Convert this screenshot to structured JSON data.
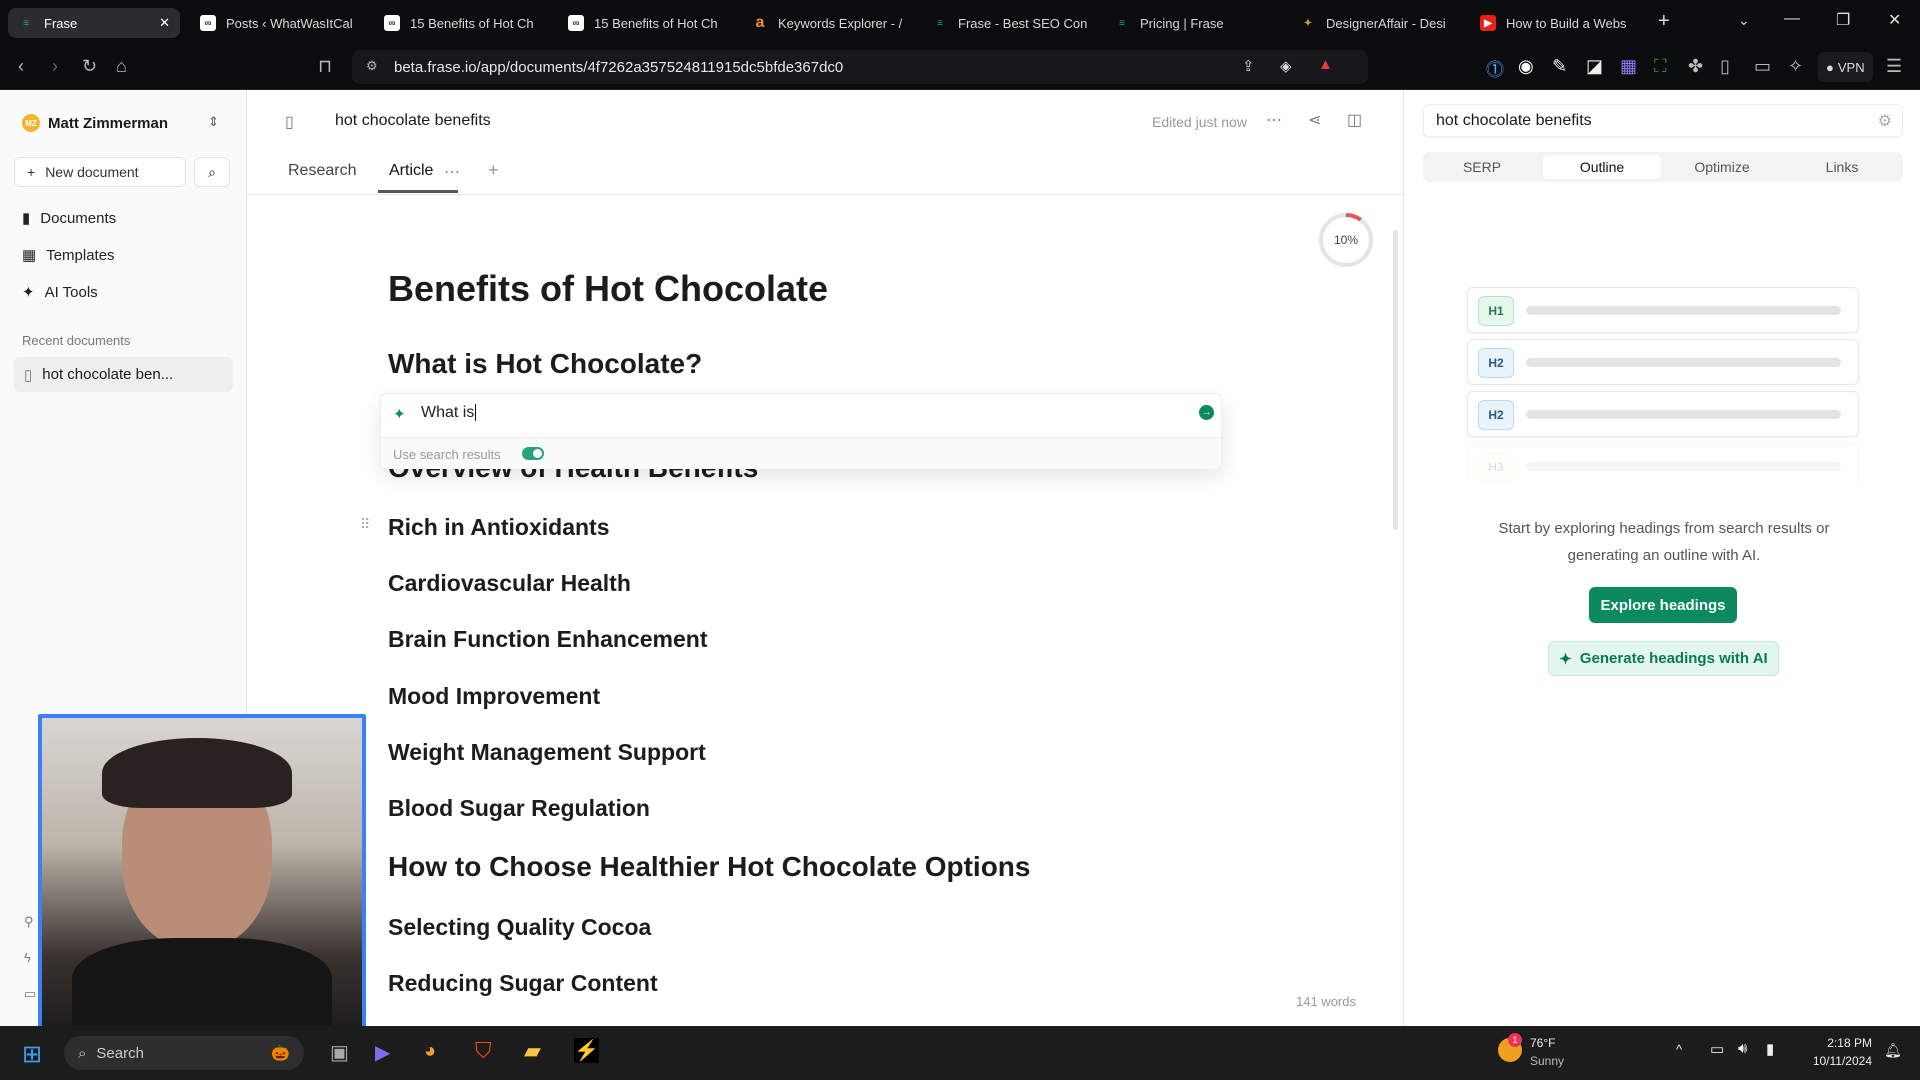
{
  "browser": {
    "tabs": [
      {
        "title": "Frase",
        "active": true
      },
      {
        "title": "Posts ‹ WhatWasItCal"
      },
      {
        "title": "15 Benefits of Hot Ch"
      },
      {
        "title": "15 Benefits of Hot Ch"
      },
      {
        "title": "Keywords Explorer - /"
      },
      {
        "title": "Frase - Best SEO Con"
      },
      {
        "title": "Pricing | Frase"
      },
      {
        "title": "DesignerAffair - Desi"
      },
      {
        "title": "How to Build a Webs"
      }
    ],
    "url": "beta.frase.io/app/documents/4f7262a357524811915dc5bfde367dc0",
    "vpn_label": "VPN"
  },
  "sidebar": {
    "user_initials": "MZ",
    "user_name": "Matt Zimmerman",
    "new_document": "New document",
    "nav": [
      {
        "label": "Documents",
        "icon": "document-icon"
      },
      {
        "label": "Templates",
        "icon": "grid-icon"
      },
      {
        "label": "AI Tools",
        "icon": "sparkle-icon"
      }
    ],
    "recent_heading": "Recent documents",
    "recent": [
      {
        "label": "hot chocolate ben..."
      }
    ]
  },
  "doc": {
    "title": "hot chocolate benefits",
    "status": "Edited just now",
    "tabs": [
      {
        "label": "Research"
      },
      {
        "label": "Article",
        "active": true
      }
    ],
    "score_percent": 10,
    "score_label": "10%",
    "word_count": "141 words",
    "headings": [
      {
        "level": 1,
        "text": "Benefits of Hot Chocolate"
      },
      {
        "level": 2,
        "text": "What is Hot Chocolate?"
      },
      {
        "level": 2,
        "text": "Overview of Health Benefits"
      },
      {
        "level": 3,
        "text": "Rich in Antioxidants"
      },
      {
        "level": 3,
        "text": "Cardiovascular Health"
      },
      {
        "level": 3,
        "text": "Brain Function Enhancement"
      },
      {
        "level": 3,
        "text": "Mood Improvement"
      },
      {
        "level": 3,
        "text": "Weight Management Support"
      },
      {
        "level": 3,
        "text": "Blood Sugar Regulation"
      },
      {
        "level": 2,
        "text": "How to Choose Healthier Hot Chocolate Options"
      },
      {
        "level": 3,
        "text": "Selecting Quality Cocoa"
      },
      {
        "level": 3,
        "text": "Reducing Sugar Content"
      }
    ],
    "ai_prompt": {
      "value": "What is",
      "toggle_label": "Use search results",
      "toggle_on": true
    }
  },
  "panel": {
    "query": "hot chocolate benefits",
    "tabs": [
      {
        "label": "SERP"
      },
      {
        "label": "Outline",
        "active": true
      },
      {
        "label": "Optimize"
      },
      {
        "label": "Links"
      }
    ],
    "outline_badges": [
      "H1",
      "H2",
      "H2",
      "H3"
    ],
    "empty_text": "Start by exploring headings from search results or generating an outline with AI.",
    "explore_button": "Explore headings",
    "generate_button": "Generate headings with AI"
  },
  "taskbar": {
    "search": "Search",
    "weather_temp": "76°F",
    "weather_desc": "Sunny",
    "weather_badge": "1",
    "time": "2:18 PM",
    "date": "10/11/2024"
  },
  "colors": {
    "accent": "#0b8a5f",
    "accent_light": "#e3f7ef",
    "progress": "#e05a5a"
  }
}
